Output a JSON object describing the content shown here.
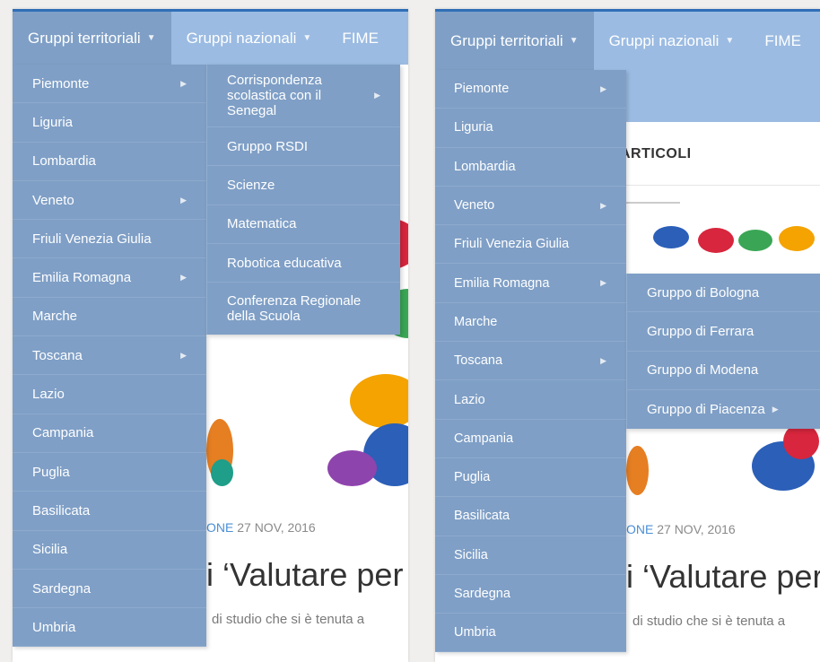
{
  "nav": {
    "items": [
      "Gruppi territoriali",
      "Gruppi nazionali",
      "FIME"
    ]
  },
  "regions": [
    "Piemonte",
    "Liguria",
    "Lombardia",
    "Veneto",
    "Friuli Venezia Giulia",
    "Emilia Romagna",
    "Marche",
    "Toscana",
    "Lazio",
    "Campania",
    "Puglia",
    "Basilicata",
    "Sicilia",
    "Sardegna",
    "Umbria"
  ],
  "left": {
    "submenu": [
      "Corrispondenza scolastica con il Senegal",
      "Gruppo RSDI",
      "Scienze",
      "Matematica",
      "Robotica educativa",
      "Conferenza Regionale della Scuola"
    ]
  },
  "right": {
    "submenu": [
      "Gruppo di Bologna",
      "Gruppo di Ferrara",
      "Gruppo di Modena",
      "Gruppo di Piacenza"
    ],
    "section_heading": "ARTICOLI"
  },
  "article": {
    "category_fragment": "ONE",
    "date": "27 NOV, 2016",
    "title_fragment": "i ‘Valutare per",
    "excerpt_fragment": "di studio che si è tenuta a"
  },
  "colors": {
    "nav_bg": "#9bbbe2",
    "menu_bg": "#7f9fc6",
    "accent_border": "#2f6fb7",
    "category_link": "#4a8fd6"
  },
  "icons": {
    "caret": "caret-down-icon",
    "submenu_arrow": "caret-right-icon"
  }
}
